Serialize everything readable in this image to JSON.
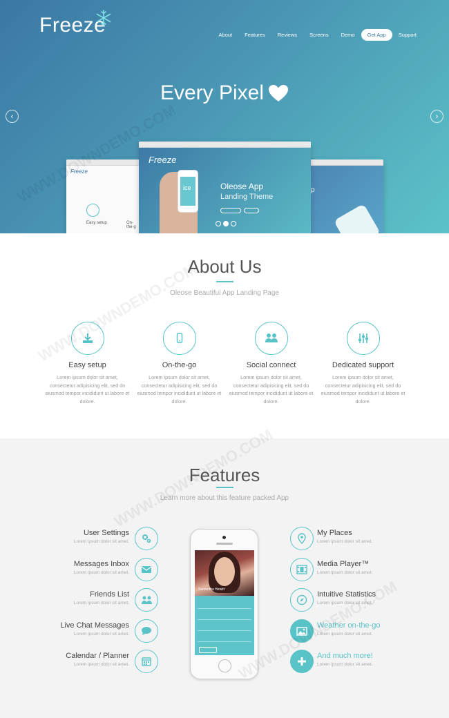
{
  "brand": {
    "name": "Freeze",
    "accent": "#59c3c8",
    "hero_gradient": [
      "#3b78a4",
      "#5cc3c8"
    ]
  },
  "nav": {
    "items": [
      {
        "label": "About"
      },
      {
        "label": "Features"
      },
      {
        "label": "Reviews"
      },
      {
        "label": "Screens"
      },
      {
        "label": "Demo"
      },
      {
        "label": "Get App"
      },
      {
        "label": "Support"
      }
    ],
    "active": "Get App"
  },
  "hero": {
    "title": "Every Pixel",
    "mockup": {
      "logo": "Freeze",
      "line1": "Oleose App",
      "line2": "Landing Theme",
      "phone_text": "ice"
    },
    "left_mockup": {
      "logo": "Freeze",
      "item1": "Easy setup",
      "item2": "On-the-g"
    },
    "right_mockup": {
      "text": "p"
    },
    "slides": 3,
    "active_slide": 2
  },
  "about": {
    "title": "About Us",
    "subtitle": "Oleose Beautiful App Landing Page",
    "items": [
      {
        "icon": "download-icon",
        "title": "Easy setup",
        "text": "Lorem ipsum dolor sit amet, consectetur adipisicing elit, sed do eiusmod tempor incididunt ut labore et dolore."
      },
      {
        "icon": "mobile-icon",
        "title": "On-the-go",
        "text": "Lorem ipsum dolor sit amet, consectetur adipisicing elit, sed do eiusmod tempor incididunt ut labore et dolore."
      },
      {
        "icon": "users-icon",
        "title": "Social connect",
        "text": "Lorem ipsum dolor sit amet, consectetur adipisicing elit, sed do eiusmod tempor incididunt ut labore et dolore."
      },
      {
        "icon": "sliders-icon",
        "title": "Dedicated support",
        "text": "Lorem ipsum dolor sit amet, consectetur adipisicing elit, sed do eiusmod tempor incididunt ut labore et dolore."
      }
    ]
  },
  "features": {
    "title": "Features",
    "subtitle": "Learn more about this feature packed App",
    "left": [
      {
        "icon": "cogs-icon",
        "title": "User Settings",
        "text": "Lorem ipsum dolor sit amet."
      },
      {
        "icon": "envelope-icon",
        "title": "Messages Inbox",
        "text": "Lorem ipsum dolor sit amet."
      },
      {
        "icon": "users-icon",
        "title": "Friends List",
        "text": "Lorem ipsum dolor sit amet."
      },
      {
        "icon": "chat-icon",
        "title": "Live Chat Messages",
        "text": "Lorem ipsum dolor sit amet."
      },
      {
        "icon": "calendar-icon",
        "title": "Calendar / Planner",
        "text": "Lorem ipsum dolor sit amet."
      }
    ],
    "right": [
      {
        "icon": "map-marker-icon",
        "title": "My Places",
        "text": "Lorem ipsum dolor sit amet.",
        "highlight": false
      },
      {
        "icon": "film-icon",
        "title": "Media Player™",
        "text": "Lorem ipsum dolor sit amet.",
        "highlight": false
      },
      {
        "icon": "compass-icon",
        "title": "Intuitive Statistics",
        "text": "Lorem ipsum dolor sit amet.",
        "highlight": false
      },
      {
        "icon": "picture-icon",
        "title": "Weather on-the-go",
        "text": "Lorem ipsum dolor sit amet.",
        "highlight": true
      },
      {
        "icon": "plus-icon",
        "title": "And much more!",
        "text": "Lorem ipsum dolor sit amet.",
        "highlight": true
      }
    ],
    "phone": {
      "name": "Samantha Hewitt"
    }
  },
  "watermark": "WWW.DOWNDEMO.COM"
}
